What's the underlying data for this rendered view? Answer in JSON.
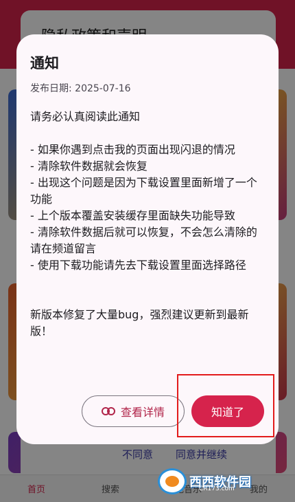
{
  "background_app": {
    "privacy_title": "隐私政策和声明",
    "privacy_disagree": "不同意",
    "privacy_agree": "同意并继续",
    "nav": [
      "首页",
      "搜索",
      "本地音乐",
      "我的"
    ]
  },
  "dialog": {
    "title": "通知",
    "date": "发布日期: 2025-07-16",
    "body_lines": [
      "请务必认真阅读此通知",
      "",
      "- 如果你遇到点击我的页面出现闪退的情况",
      "- 清除软件数据就会恢复",
      "- 出现这个问题是因为下载设置里面新增了一个功能",
      "- 上个版本覆盖安装缓存里面缺失功能导致",
      "- 清除软件数据后就可以恢复，不会怎么清除的请在频道留言",
      "- 使用下载功能请先去下载设置里面选择路径",
      "",
      "",
      "新版本修复了大量bug，强烈建议更新到最新版！"
    ],
    "details_button": "查看详情",
    "ok_button": "知道了"
  },
  "watermark": {
    "text": "西西软件园",
    "sub": "CR173.com"
  },
  "colors": {
    "accent": "#d6234c",
    "dialog_bg": "#fdf7fb",
    "highlight": "#e21b1b"
  }
}
